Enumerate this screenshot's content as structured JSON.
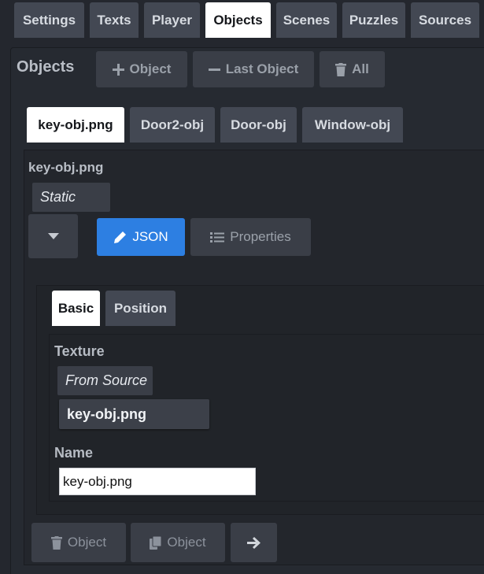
{
  "top_tabs": [
    {
      "label": "Settings",
      "active": false
    },
    {
      "label": "Texts",
      "active": false
    },
    {
      "label": "Player",
      "active": false
    },
    {
      "label": "Objects",
      "active": true
    },
    {
      "label": "Scenes",
      "active": false
    },
    {
      "label": "Puzzles",
      "active": false
    },
    {
      "label": "Sources",
      "active": false
    }
  ],
  "objects_panel": {
    "title": "Objects",
    "add_object_label": "Object",
    "remove_last_label": "Last Object",
    "delete_all_label": "All"
  },
  "object_tabs": [
    {
      "label": "key-obj.png",
      "active": true
    },
    {
      "label": "Door2-obj",
      "active": false
    },
    {
      "label": "Door-obj",
      "active": false
    },
    {
      "label": "Window-obj",
      "active": false
    }
  ],
  "object_editor": {
    "heading": "key-obj.png",
    "type_value": "Static",
    "json_label": "JSON",
    "properties_label": "Properties"
  },
  "sub_tabs": [
    {
      "label": "Basic",
      "active": true
    },
    {
      "label": "Position",
      "active": false
    }
  ],
  "basic_form": {
    "texture_label": "Texture",
    "texture_source": "From Source",
    "texture_value": "key-obj.png",
    "name_label": "Name",
    "name_value": "key-obj.png"
  },
  "footer": {
    "delete_object_label": "Object",
    "copy_object_label": "Object"
  },
  "colors": {
    "background": "#24272e",
    "active_tab": "#ffffff",
    "inactive_tab": "#434853",
    "primary": "#2d7fe2"
  }
}
